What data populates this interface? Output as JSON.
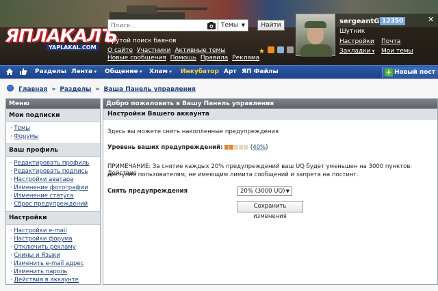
{
  "header": {
    "logo_text": "ЯПЛАКАЛЪ",
    "logo_sub": "YAPLAKAL.COM",
    "search_placeholder": "Поиск...",
    "search_scope": "Темы",
    "search_button": "Найти",
    "tagline": "Крутой поиск баянов",
    "links_row1": [
      "О сайте",
      "Участники",
      "Активные темы"
    ],
    "links_row2": [
      "Новые сообщения",
      "Помощь",
      "Правила",
      "Реклама"
    ]
  },
  "user": {
    "name": "sergeantGY",
    "reputation": "12350",
    "rank": "Шутник",
    "close": "✕",
    "links": {
      "settings": "Настройки",
      "mail": "Почта",
      "bookmarks": "Закладки",
      "my_topics": "Мои темы"
    }
  },
  "nav": {
    "items": [
      "Разделы",
      "Лента",
      "Общение",
      "Хлам",
      "Инкубатор",
      "Арт",
      "ЯП Файлы"
    ],
    "new_post": "Новый пост"
  },
  "breadcrumb": {
    "home": "Главная",
    "sections": "Разделы",
    "current": "Ваша Панель управления",
    "sep": "»"
  },
  "sidebar": {
    "title": "Меню",
    "groups": [
      {
        "title": "Мои подписки",
        "items": [
          "Темы",
          "Форумы"
        ]
      },
      {
        "title": "Ваш профиль",
        "items": [
          "Редактировать профиль",
          "Редактировать подпись",
          "Настройки аватара",
          "Изменение фотографии",
          "Изменение статуса",
          "Сброс предупреждений"
        ]
      },
      {
        "title": "Настройки",
        "items": [
          "Настройки e-mail",
          "Настройки форума",
          "Отключить рекламу",
          "Скины и Языки",
          "Изменить e-mail адрес",
          "Изменить пароль",
          "Действия в аккаунте"
        ]
      }
    ]
  },
  "main": {
    "title": "Добро пожаловать в Вашу Панель управления",
    "subtitle": "Настройки Вашего аккаунта",
    "intro": "Здесь вы можете снять накопленные предупреждения",
    "warn_label": "Уровень ваших предупреждений:",
    "warn_percent": "40%",
    "warn_level": 0.4,
    "note_line1": "ПРИМЕЧАНИЕ: За снятие каждых 20% предупреждений ваш UQ будет уменьшен на 3000 пунктов. Действие",
    "note_line2": "доступно пользователям, не имеющим лимита сообщений и запрета на постинг.",
    "remove_label": "Снять предупреждения",
    "remove_value": "20% (3000 UQ)",
    "save_button": "Сохранить изменения"
  }
}
